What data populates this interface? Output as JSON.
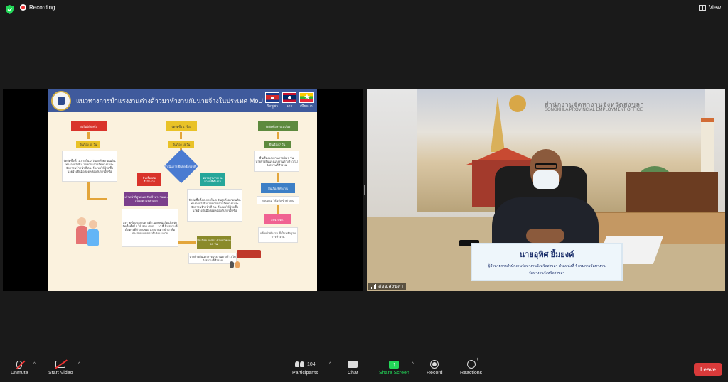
{
  "topbar": {
    "recording_label": "Recording",
    "view_label": "View",
    "shield_color": "#23d959",
    "recording_color": "#e33333"
  },
  "slide": {
    "title": "แนวทางการนำแรงงานต่างด้าวมาทำงานกับนายจ้างในประเทศ MoU",
    "flags": [
      "กัมพูชา",
      "ลาว",
      "เมียนมา"
    ],
    "boxes": {
      "col1_head": "ยังไม่ได้จัดซื้อ",
      "col1_step": "ยื่นเรื่อง 45 วัน",
      "col2_head": "จัดจัดซื้อ 1 เรื่อง",
      "col2_step": "ยื่นเรื่อง 15 วัน",
      "col3_head": "จัดจัดซื้อครบ 1 เรื่อง",
      "col3_step": "ยื่นเรื่อง 7 วัน",
      "diamond": "ดำเนินการ ยื่นจัดซื้อรอบที่ 2",
      "left_note": "จัดจัดซื้อทั้ง 1 ภายใน 2 วันสุดท้าย ก่อนเดินทางออกไปยื่น โดยกรมการจัดหางานจะจัดการ เจ้าหน้าที่ ตม. ร้องขอให้ผู้จัดซื้อ นายจ้างยื่นมือสอดคล้องกับการจัดซื้อ",
      "mid_note": "จัดจัดซื้อทั้ง 2 ภายใน 3 วันสุดท้าย ก่อนเดินทางออกไปยื่น โดยกรมการจัดหางานจะจัดการ เจ้าหน้าที่ ตม. ร้องขอให้ผู้จัดซื้อ นายจ้างยื่นมือสอดคล้องกับการจัดซื้อ",
      "right_note": "ยื่นเรื่องแรงงานภายใน 7 วัน นายจ้างยื่นแจ้งแรงงานต่างด้าว ไปยังสถานที่ทำงาน",
      "orange_left": "ยื่นเรื่องต่อ สำนักงาน",
      "orange_mid": "ตรวจสุขภาพ ณ สถานที่ทำงาน",
      "purple": "เจ้าหน้าที่ศูนย์แรกรับเข้าทำงานและอบรมตามหลักสูตร",
      "purple_note": "ส่งรายชื่อแรงงานต่างด้าวและหนังสือแจ้ง จัดจัดซื้อทั้งที่ 2 ให้ สจจ./สจก. 1-10 ที่เป็นสถานที่ตั้ง ตรงที่ทำงานของ แรงงานต่างด้าว เพื่อประสานงานการนำส่งแรงงาน",
      "blue_right": "ยื่นเรื่องที่ทำงาน",
      "right_small": "สอบถาม วิธีแจ้งเข้าทำงาน",
      "pink_right": "สจจ./สจก.",
      "right_bottom": "แจ้งเข้าทำงาน ที่เป็นหลักฐานการทำงาน",
      "olive_mid": "ยื่นเรื่องเอกสาร ตามกำหนด 15 วัน",
      "bottom_note": "นายจ้างยื่นเอกสารแรงงานต่างด้าว ไปยังสถานที่ทำงาน"
    }
  },
  "camera": {
    "office_name_th": "สำนักงานจัดหางานจังหวัดสงขลา",
    "office_name_en": "SONGKHLA PROVINCIAL EMPLOYMENT OFFICE",
    "nameplate_name": "นายอุทิศ ยิ้มยงค์",
    "nameplate_title": "ผู้อำนวยการสำนักงานจัดหางานจังหวัดสงขลา ตำแหน่งที่ 4 กรมการจัดหางาน",
    "nameplate_sub": "จัดหางานจังหวัดสงขลา",
    "participant_label": "สจจ.สงขลา"
  },
  "toolbar": {
    "unmute": "Unmute",
    "start_video": "Start Video",
    "participants": "Participants",
    "participants_count": "104",
    "chat": "Chat",
    "share_screen": "Share Screen",
    "record": "Record",
    "reactions": "Reactions",
    "leave": "Leave",
    "share_color": "#23d959",
    "leave_color": "#d93a3a"
  }
}
